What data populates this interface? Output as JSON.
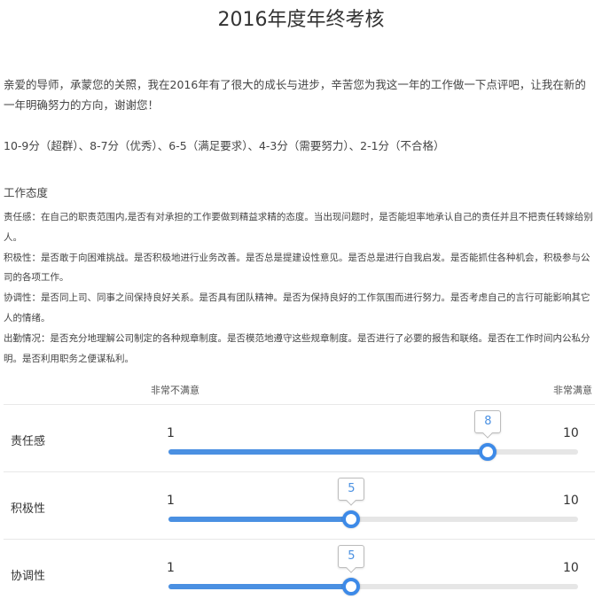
{
  "page": {
    "title": "2016年度年终考核",
    "intro": "亲爱的导师，承蒙您的关照，我在2016年有了很大的成长与进步，辛苦您为我这一年的工作做一下点评吧，让我在新的一年明确努力的方向，谢谢您！",
    "scale_line": "10-9分（超群）、8-7分（优秀）、6-5（满足要求）、4-3分（需要努力）、2-1分（不合格）"
  },
  "section": {
    "title": "工作态度",
    "descriptions": [
      "责任感：在自己的职责范围内,是否有对承担的工作要做到精益求精的态度。当出现问题时，是否能坦率地承认自己的责任并且不把责任转嫁给别人。",
      "积极性：是否敢于向困难挑战。是否积极地进行业务改善。是否总是提建设性意见。是否总是进行自我启发。是否能抓住各种机会，积极参与公司的各项工作。",
      "协调性：是否同上司、同事之间保持良好关系。是否具有团队精神。是否为保持良好的工作氛围而进行努力。是否考虑自己的言行可能影响其它人的情绪。",
      "出勤情况：是否充分地理解公司制定的各种规章制度。是否模范地遵守这些规章制度。是否进行了必要的报告和联络。是否在工作时间内公私分明。是否利用职务之便谋私利。"
    ],
    "low_label": "非常不满意",
    "high_label": "非常满意"
  },
  "sliders": [
    {
      "name": "责任感",
      "min": "1",
      "max": "10",
      "value": 8,
      "value_label": "8"
    },
    {
      "name": "积极性",
      "min": "1",
      "max": "10",
      "value": 5,
      "value_label": "5"
    },
    {
      "name": "协调性",
      "min": "1",
      "max": "10",
      "value": 5,
      "value_label": "5"
    }
  ],
  "colors": {
    "accent": "#4a90e2",
    "track": "#e6e6e6"
  }
}
